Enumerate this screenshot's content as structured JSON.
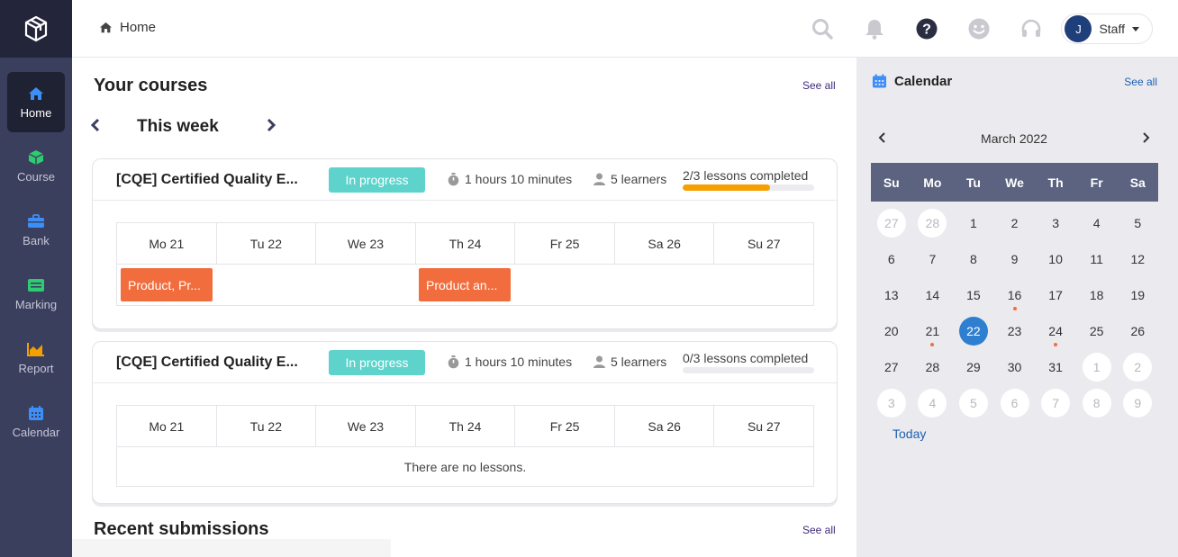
{
  "sidebar": {
    "items": [
      {
        "label": "Home",
        "icon": "home-icon",
        "color": "#3e8ef7",
        "active": true
      },
      {
        "label": "Course",
        "icon": "box-icon",
        "color": "#2ecc71"
      },
      {
        "label": "Bank",
        "icon": "briefcase-icon",
        "color": "#3e8ef7"
      },
      {
        "label": "Marking",
        "icon": "marking-icon",
        "color": "#2ecc71"
      },
      {
        "label": "Report",
        "icon": "chart-icon",
        "color": "#f5a000"
      },
      {
        "label": "Calendar",
        "icon": "calendar-icon",
        "color": "#3e8ef7"
      }
    ]
  },
  "header": {
    "breadcrumb": "Home",
    "user_initial": "J",
    "user_role": "Staff"
  },
  "main": {
    "courses_title": "Your courses",
    "see_all": "See all",
    "week_label": "This week",
    "recent_title": "Recent submissions",
    "courses": [
      {
        "title": "[CQE] Certified Quality E...",
        "status": "In progress",
        "duration": "1 hours 10 minutes",
        "learners": "5 learners",
        "progress_text": "2/3 lessons completed",
        "progress_fraction": 0.667,
        "days": [
          "Mo 21",
          "Tu 22",
          "We 23",
          "Th 24",
          "Fr 25",
          "Sa 26",
          "Su 27"
        ],
        "lessons": [
          {
            "label": "Product, Pr...",
            "day_index": 0
          },
          {
            "label": "Product an...",
            "day_index": 3
          }
        ]
      },
      {
        "title": "[CQE] Certified Quality E...",
        "status": "In progress",
        "duration": "1 hours 10 minutes",
        "learners": "5 learners",
        "progress_text": "0/3 lessons completed",
        "progress_fraction": 0,
        "days": [
          "Mo 21",
          "Tu 22",
          "We 23",
          "Th 24",
          "Fr 25",
          "Sa 26",
          "Su 27"
        ],
        "no_lessons": "There are no lessons."
      }
    ]
  },
  "calendar": {
    "title": "Calendar",
    "see_all": "See all",
    "month": "March 2022",
    "weekdays": [
      "Su",
      "Mo",
      "Tu",
      "We",
      "Th",
      "Fr",
      "Sa"
    ],
    "weeks": [
      [
        {
          "d": "27",
          "other": true
        },
        {
          "d": "28",
          "other": true
        },
        {
          "d": "1"
        },
        {
          "d": "2"
        },
        {
          "d": "3"
        },
        {
          "d": "4"
        },
        {
          "d": "5"
        }
      ],
      [
        {
          "d": "6"
        },
        {
          "d": "7"
        },
        {
          "d": "8"
        },
        {
          "d": "9"
        },
        {
          "d": "10"
        },
        {
          "d": "11"
        },
        {
          "d": "12"
        }
      ],
      [
        {
          "d": "13"
        },
        {
          "d": "14"
        },
        {
          "d": "15"
        },
        {
          "d": "16",
          "dot": true
        },
        {
          "d": "17"
        },
        {
          "d": "18"
        },
        {
          "d": "19"
        }
      ],
      [
        {
          "d": "20"
        },
        {
          "d": "21",
          "dot": true
        },
        {
          "d": "22",
          "today": true
        },
        {
          "d": "23"
        },
        {
          "d": "24",
          "dot": true
        },
        {
          "d": "25"
        },
        {
          "d": "26"
        }
      ],
      [
        {
          "d": "27"
        },
        {
          "d": "28"
        },
        {
          "d": "29"
        },
        {
          "d": "30"
        },
        {
          "d": "31"
        },
        {
          "d": "1",
          "other": true
        },
        {
          "d": "2",
          "other": true
        }
      ],
      [
        {
          "d": "3",
          "other": true
        },
        {
          "d": "4",
          "other": true
        },
        {
          "d": "5",
          "other": true
        },
        {
          "d": "6",
          "other": true
        },
        {
          "d": "7",
          "other": true
        },
        {
          "d": "8",
          "other": true
        },
        {
          "d": "9",
          "other": true
        }
      ]
    ],
    "today_label": "Today"
  },
  "colors": {
    "sidebar_bg": "#3b3f5e",
    "accent_badge": "#5dd3cc",
    "lesson_chip": "#f26d3d",
    "progress": "#f5a000",
    "calendar_header": "#5c6380",
    "today": "#2f7fd1"
  }
}
